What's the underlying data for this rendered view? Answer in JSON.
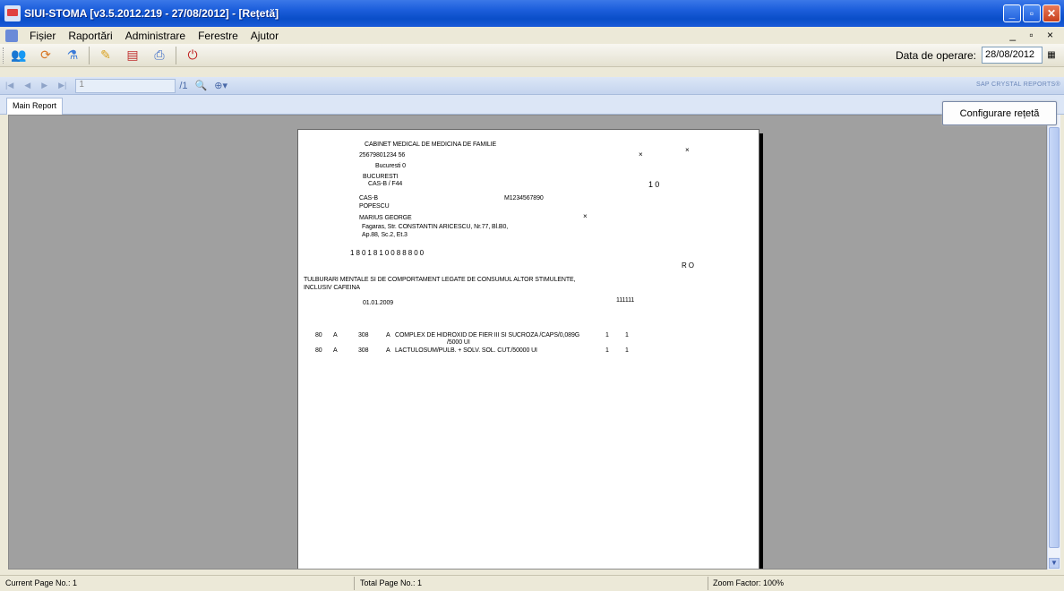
{
  "window": {
    "title": "SIUI-STOMA [v3.5.2012.219 - 27/08/2012] - [Rețetă]"
  },
  "menu": {
    "items": [
      "Fișier",
      "Raportări",
      "Administrare",
      "Ferestre",
      "Ajutor"
    ],
    "mdi_controls": "_ ▫ ×"
  },
  "toolbar": {
    "date_label": "Data de operare:",
    "date_value": "28/08/2012"
  },
  "crystal": {
    "page_input": "1",
    "brand": "SAP CRYSTAL REPORTS®"
  },
  "tab": {
    "label": "Main Report"
  },
  "config_button": "Configurare rețetă",
  "report": {
    "clinic": "CABINET MEDICAL DE MEDICINA DE FAMILIE",
    "code": "25679801234 56",
    "city": "Bucuresti 0",
    "county": "BUCURESTI",
    "cas_line": "CAS-B / F44",
    "x1": "×",
    "x2": "×",
    "num_10": "1 0",
    "cas": "CAS-B",
    "contract": "M1234567890",
    "surname": "POPESCU",
    "name": "MARIUS GEORGE",
    "x3": "×",
    "address1": "Fagaras, Str. CONSTANTIN ARICESCU, Nr.77, Bl.B0,",
    "address2": "Ap.88, Sc.2, Et.3",
    "cnp": "1 8 0 1 8 1 0 0 8 8 8 0 0",
    "ro": "R  O",
    "diagnosis1": "TULBURARI MENTALE SI DE COMPORTAMENT LEGATE DE CONSUMUL ALTOR STIMULENTE,",
    "diagnosis2": "INCLUSIV CAFEINA",
    "date": "01.01.2009",
    "code2": "111111",
    "rows": [
      {
        "c1": "80",
        "c2": "A",
        "c3": "308",
        "c4": "A",
        "desc": "COMPLEX DE HIDROXID DE FIER III SI SUCROZA /CAPS/0,089G",
        "desc2": "/5000 UI",
        "qty": "1",
        "unit": "1"
      },
      {
        "c1": "80",
        "c2": "A",
        "c3": "308",
        "c4": "A",
        "desc": "LACTULOSUM/PULB. + SOLV. SOL. CUT./50000 UI",
        "desc2": "",
        "qty": "1",
        "unit": "1"
      }
    ]
  },
  "status": {
    "current_page": "Current Page No.: 1",
    "total_page": "Total Page No.: 1",
    "zoom": "Zoom Factor: 100%"
  }
}
